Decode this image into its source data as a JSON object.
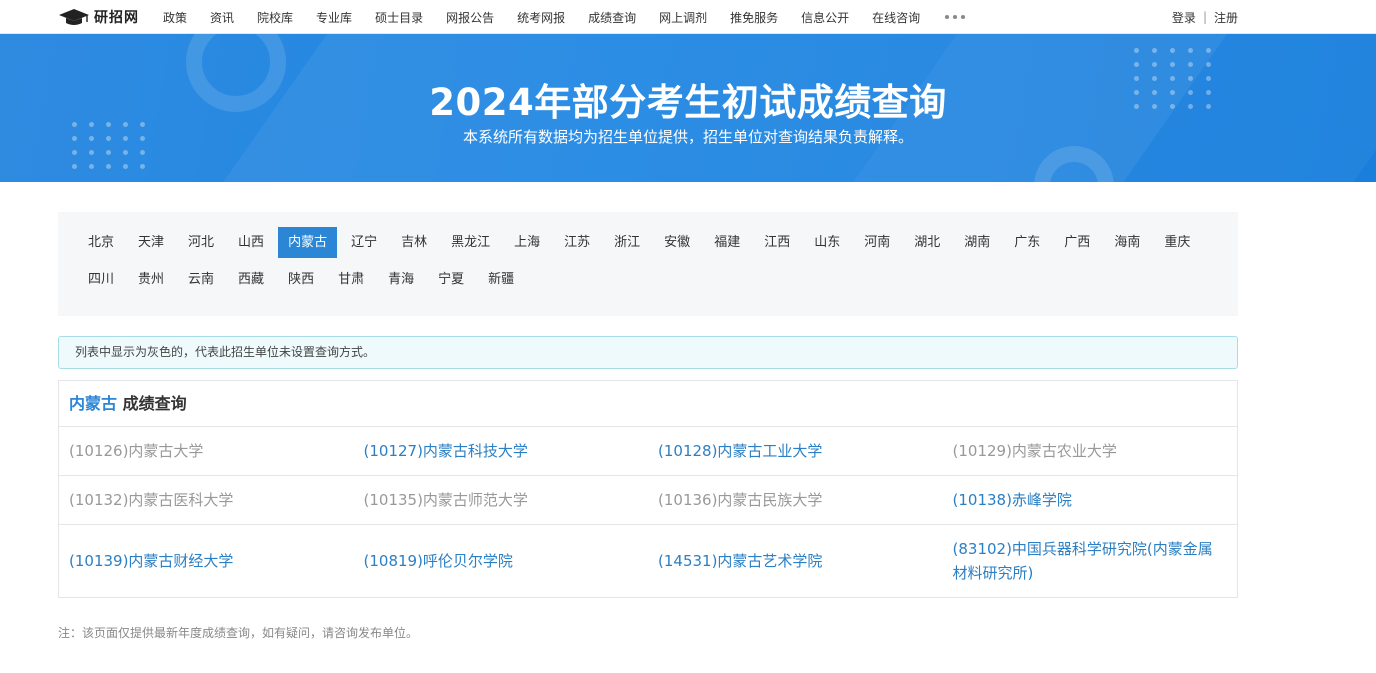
{
  "header": {
    "logo_text": "研招网",
    "nav": [
      "政策",
      "资讯",
      "院校库",
      "专业库",
      "硕士目录",
      "网报公告",
      "统考网报",
      "成绩查询",
      "网上调剂",
      "推免服务",
      "信息公开",
      "在线咨询"
    ],
    "login": "登录",
    "separator": "|",
    "register": "注册"
  },
  "banner": {
    "title": "2024年部分考生初试成绩查询",
    "subtitle": "本系统所有数据均为招生单位提供，招生单位对查询结果负责解释。"
  },
  "provinces": {
    "items": [
      "北京",
      "天津",
      "河北",
      "山西",
      "内蒙古",
      "辽宁",
      "吉林",
      "黑龙江",
      "上海",
      "江苏",
      "浙江",
      "安徽",
      "福建",
      "江西",
      "山东",
      "河南",
      "湖北",
      "湖南",
      "广东",
      "广西",
      "海南",
      "重庆",
      "四川",
      "贵州",
      "云南",
      "西藏",
      "陕西",
      "甘肃",
      "青海",
      "宁夏",
      "新疆"
    ],
    "active": "内蒙古"
  },
  "notice": "列表中显示为灰色的，代表此招生单位未设置查询方式。",
  "results": {
    "province": "内蒙古",
    "heading_suffix": " 成绩查询",
    "rows": [
      [
        {
          "label": "(10126)内蒙古大学",
          "available": false
        },
        {
          "label": "(10127)内蒙古科技大学",
          "available": true
        },
        {
          "label": "(10128)内蒙古工业大学",
          "available": true
        },
        {
          "label": "(10129)内蒙古农业大学",
          "available": false
        }
      ],
      [
        {
          "label": "(10132)内蒙古医科大学",
          "available": false
        },
        {
          "label": "(10135)内蒙古师范大学",
          "available": false
        },
        {
          "label": "(10136)内蒙古民族大学",
          "available": false
        },
        {
          "label": "(10138)赤峰学院",
          "available": true
        }
      ],
      [
        {
          "label": "(10139)内蒙古财经大学",
          "available": true
        },
        {
          "label": "(10819)呼伦贝尔学院",
          "available": true
        },
        {
          "label": "(14531)内蒙古艺术学院",
          "available": true
        },
        {
          "label": "(83102)中国兵器科学研究院(内蒙金属材料研究所)",
          "available": true
        }
      ]
    ]
  },
  "footnote": "注：该页面仅提供最新年度成绩查询，如有疑问，请咨询发布单位。",
  "colors": {
    "brand_blue": "#1f86e3",
    "active_province": "#2b86d6",
    "link": "#2b7fc4",
    "unavailable": "#999999"
  }
}
